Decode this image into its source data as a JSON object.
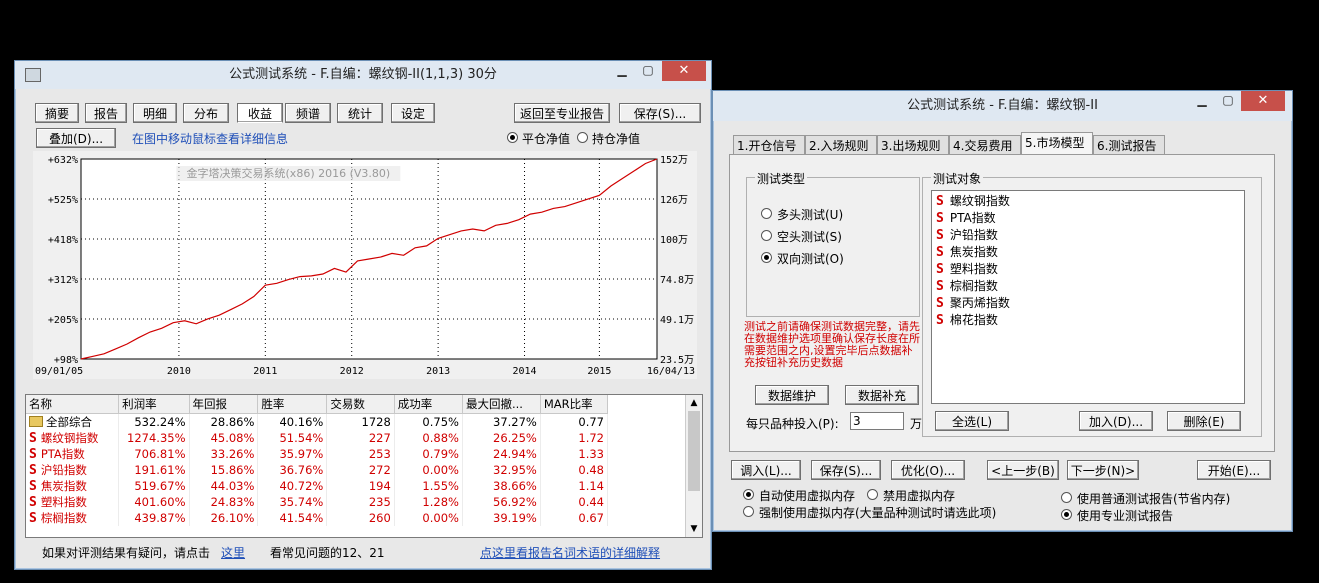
{
  "win1": {
    "title": "公式测试系统 - F.自编：螺纹钢-II(1,1,3) 30分",
    "tabs": [
      "摘要",
      "报告",
      "明细",
      "分布",
      "收益",
      "频谱",
      "统计",
      "设定"
    ],
    "active_tab": 4,
    "return_label": "返回至专业报告",
    "save_label": "保存(S)...",
    "overlay_label": "叠加(D)...",
    "hint": "在图中移动鼠标查看详细信息",
    "radio_flat": "平仓净值",
    "radio_hold": "持仓净值",
    "watermark": "金字塔决策交易系统(x86) 2016 (V3.80)",
    "footer_text": "如果对评测结果有疑问，请点击",
    "footer_link": "这里",
    "footer_faq": "看常见问题的12、21",
    "footer_link2": "点这里看报告名词术语的详细解释",
    "columns": [
      "名称",
      "利润率",
      "年回报",
      "胜率",
      "交易数",
      "成功率",
      "最大回撤...",
      "MAR比率"
    ],
    "rows": [
      {
        "name": "全部综合",
        "profit": "532.24%",
        "annual": "28.86%",
        "win": "40.16%",
        "trades": "1728",
        "success": "0.75%",
        "dd": "37.27%",
        "mar": "0.77",
        "red": false,
        "folder": true
      },
      {
        "name": "螺纹钢指数",
        "profit": "1274.35%",
        "annual": "45.08%",
        "win": "51.54%",
        "trades": "227",
        "success": "0.88%",
        "dd": "26.25%",
        "mar": "1.72",
        "red": true
      },
      {
        "name": "PTA指数",
        "profit": "706.81%",
        "annual": "33.26%",
        "win": "35.97%",
        "trades": "253",
        "success": "0.79%",
        "dd": "24.94%",
        "mar": "1.33",
        "red": true
      },
      {
        "name": "沪铅指数",
        "profit": "191.61%",
        "annual": "15.86%",
        "win": "36.76%",
        "trades": "272",
        "success": "0.00%",
        "dd": "32.95%",
        "mar": "0.48",
        "red": true
      },
      {
        "name": "焦炭指数",
        "profit": "519.67%",
        "annual": "44.03%",
        "win": "40.72%",
        "trades": "194",
        "success": "1.55%",
        "dd": "38.66%",
        "mar": "1.14",
        "red": true
      },
      {
        "name": "塑料指数",
        "profit": "401.60%",
        "annual": "24.83%",
        "win": "35.74%",
        "trades": "235",
        "success": "1.28%",
        "dd": "56.92%",
        "mar": "0.44",
        "red": true
      },
      {
        "name": "棕榈指数",
        "profit": "439.87%",
        "annual": "26.10%",
        "win": "41.54%",
        "trades": "260",
        "success": "0.00%",
        "dd": "39.19%",
        "mar": "0.67",
        "red": true
      }
    ]
  },
  "chart_data": {
    "type": "line",
    "y_left_ticks": [
      "+632%",
      "+525%",
      "+418%",
      "+312%",
      "+205%",
      "+98%"
    ],
    "y_right_ticks": [
      "152万",
      "126万",
      "100万",
      "74.8万",
      "49.1万",
      "23.5万"
    ],
    "x_ticks": [
      "09/01/05",
      "2010",
      "2011",
      "2012",
      "2013",
      "2014",
      "2015",
      "16/04/13"
    ],
    "ylim": [
      98,
      632
    ],
    "series": [
      {
        "color": "#d00000",
        "x": [
          0,
          0.02,
          0.04,
          0.06,
          0.08,
          0.1,
          0.12,
          0.14,
          0.16,
          0.18,
          0.2,
          0.22,
          0.24,
          0.26,
          0.28,
          0.3,
          0.32,
          0.34,
          0.36,
          0.38,
          0.4,
          0.42,
          0.44,
          0.46,
          0.48,
          0.5,
          0.52,
          0.54,
          0.56,
          0.58,
          0.6,
          0.62,
          0.64,
          0.66,
          0.68,
          0.7,
          0.72,
          0.74,
          0.76,
          0.78,
          0.8,
          0.82,
          0.84,
          0.86,
          0.88,
          0.9,
          0.92,
          0.94,
          0.96,
          0.98,
          1.0
        ],
        "y": [
          98,
          105,
          112,
          125,
          138,
          155,
          170,
          180,
          195,
          200,
          192,
          205,
          215,
          230,
          245,
          265,
          295,
          300,
          310,
          318,
          320,
          325,
          340,
          330,
          360,
          365,
          370,
          380,
          375,
          395,
          400,
          420,
          430,
          440,
          445,
          440,
          455,
          460,
          470,
          485,
          490,
          500,
          505,
          515,
          525,
          535,
          560,
          580,
          600,
          620,
          640
        ]
      }
    ]
  },
  "win2": {
    "title": "公式测试系统 - F.自编：螺纹钢-II",
    "tabs": [
      "1.开仓信号",
      "2.入场规则",
      "3.出场规则",
      "4.交易费用",
      "5.市场模型",
      "6.测试报告"
    ],
    "active_tab": 4,
    "group_type": "测试类型",
    "types": [
      "多头测试(U)",
      "空头测试(S)",
      "双向测试(O)"
    ],
    "type_selected": 2,
    "warning": "测试之前请确保测试数据完整，请先在数据维护选项里确认保存长度在所需要范围之内,设置完毕后点数据补充按钮补充历史数据",
    "btn_maintain": "数据维护",
    "btn_supplement": "数据补充",
    "invest_label": "每只品种投入(P):",
    "invest_value": "3",
    "invest_unit": "万",
    "group_objects": "测试对象",
    "objects": [
      "螺纹钢指数",
      "PTA指数",
      "沪铅指数",
      "焦炭指数",
      "塑料指数",
      "棕榈指数",
      "聚丙烯指数",
      "棉花指数"
    ],
    "btn_select_all": "全选(L)",
    "btn_add": "加入(D)...",
    "btn_delete": "删除(E)",
    "bottom_buttons": [
      "调入(L)...",
      "保存(S)...",
      "优化(O)...",
      "<上一步(B)",
      "下一步(N)>",
      "开始(E)..."
    ],
    "mem_auto": "自动使用虚拟内存",
    "mem_disable": "禁用虚拟内存",
    "mem_force": "强制使用虚拟内存(大量品种测试时请选此项)",
    "report_normal": "使用普通测试报告(节省内存)",
    "report_pro": "使用专业测试报告"
  }
}
